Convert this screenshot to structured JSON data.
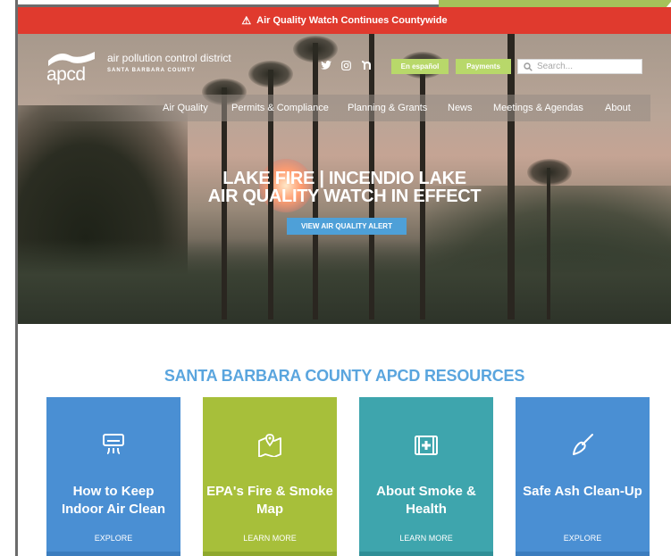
{
  "alert_bar": {
    "text": "Air Quality Watch Continues Countywide",
    "icon": "warning-triangle-icon"
  },
  "branding": {
    "logo_text": "apcd",
    "org_line1": "air pollution control district",
    "org_line2": "SANTA BARBARA COUNTY"
  },
  "social": {
    "twitter": "twitter-icon",
    "instagram": "instagram-icon",
    "nextdoor": "nextdoor-icon"
  },
  "header_buttons": {
    "spanish": "En español",
    "payments": "Payments"
  },
  "search": {
    "placeholder": "Search..."
  },
  "menu": {
    "items": [
      "Air Quality",
      "Permits & Compliance",
      "Planning & Grants",
      "News",
      "Meetings & Agendas",
      "About"
    ]
  },
  "hero": {
    "title_line1": "LAKE FIRE | INCENDIO LAKE",
    "title_line2": "AIR QUALITY WATCH IN EFFECT",
    "button": "VIEW AIR QUALITY ALERT"
  },
  "resources": {
    "heading": "SANTA BARBARA COUNTY APCD RESOURCES",
    "cards": [
      {
        "title_line1": "How to Keep",
        "title_line2": "Indoor Air Clean",
        "link": "EXPLORE",
        "icon": "air-conditioner-icon",
        "color": "#4a8fd3",
        "foot": "#3b7dbf"
      },
      {
        "title_line1": "EPA's Fire & Smoke",
        "title_line2": "Map",
        "link": "LEARN MORE",
        "icon": "map-pin-icon",
        "color": "#a7bf3a",
        "foot": "#8fa82d"
      },
      {
        "title_line1": "About Smoke &",
        "title_line2": "Health",
        "link": "LEARN MORE",
        "icon": "first-aid-kit-icon",
        "color": "#3ea5ad",
        "foot": "#2f8f97"
      },
      {
        "title_line1": "Safe Ash Clean-Up",
        "title_line2": "",
        "link": "EXPLORE",
        "icon": "brush-icon",
        "color": "#4a8fd3",
        "foot": "#3b7dbf"
      }
    ]
  }
}
